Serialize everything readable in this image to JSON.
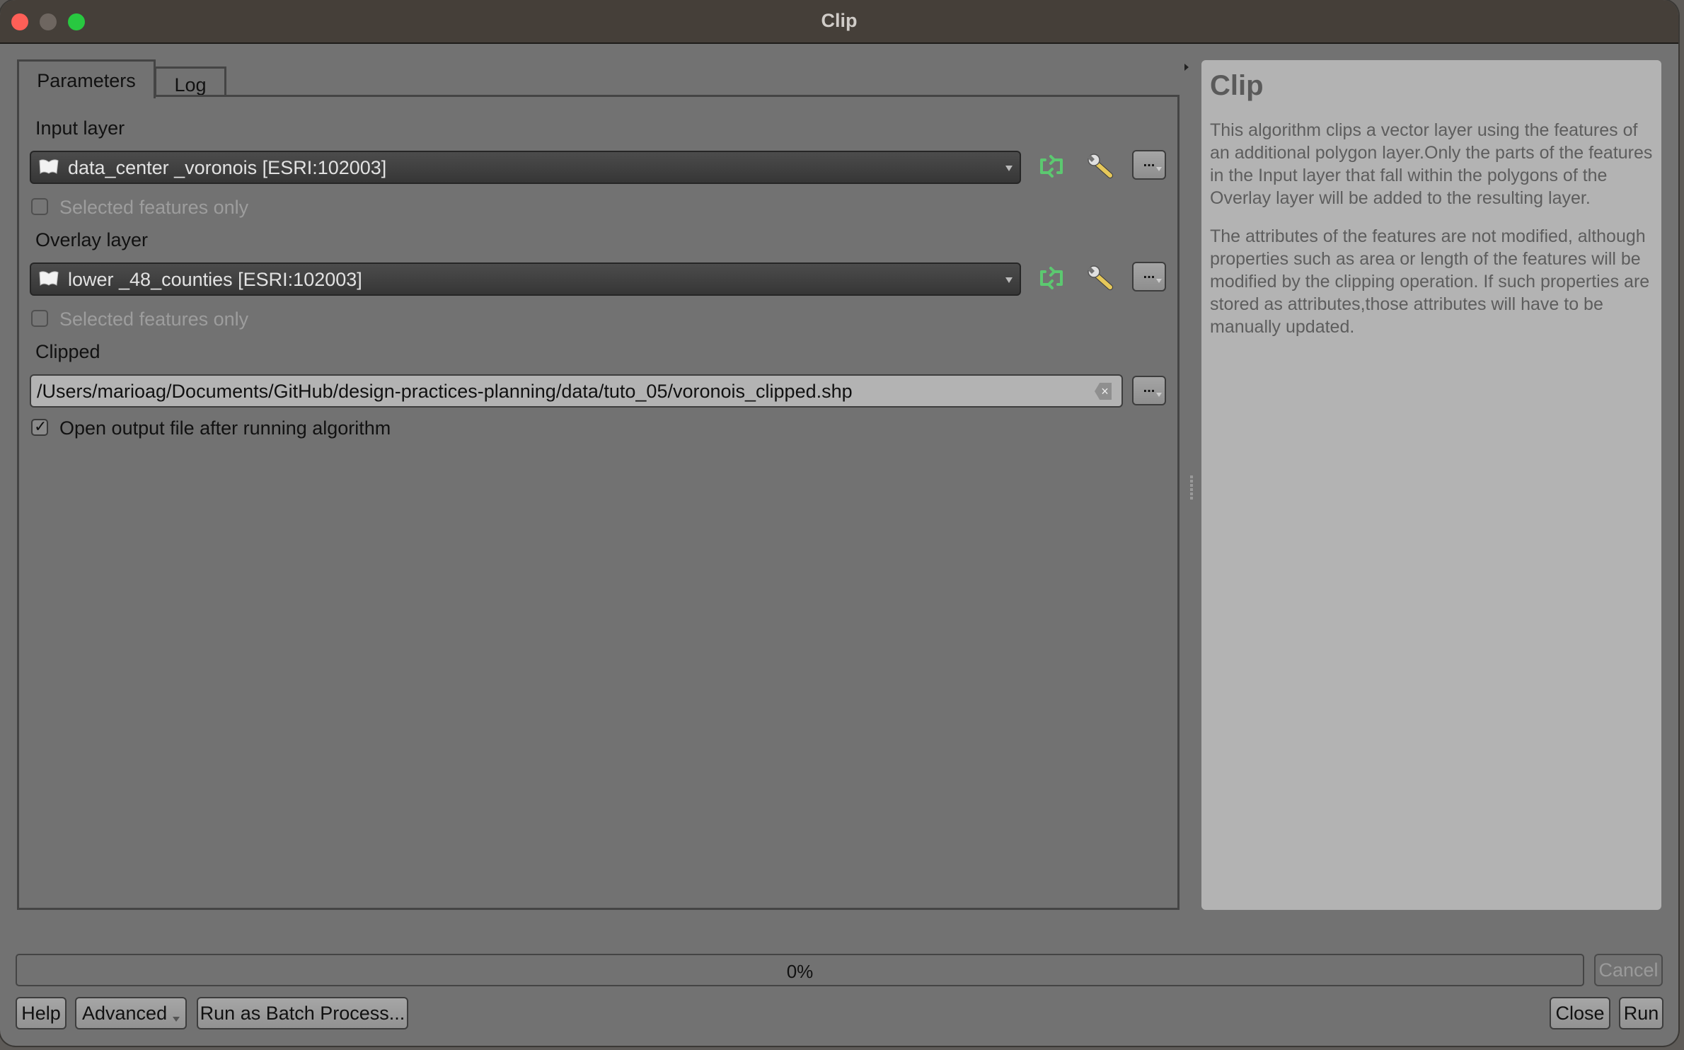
{
  "window": {
    "title": "Clip"
  },
  "tabs": [
    {
      "label": "Parameters",
      "active": true
    },
    {
      "label": "Log",
      "active": false
    }
  ],
  "params": {
    "input_layer": {
      "label": "Input layer",
      "value": "data_center _voronois [ESRI:102003]",
      "icon": "polygon-layer-icon",
      "selected_only_label": "Selected features only",
      "selected_only_checked": false
    },
    "overlay_layer": {
      "label": "Overlay layer",
      "value": "lower _48_counties [ESRI:102003]",
      "icon": "polygon-layer-icon",
      "selected_only_label": "Selected features only",
      "selected_only_checked": false
    },
    "clipped": {
      "label": "Clipped",
      "value": "/Users/marioag/Documents/GitHub/design-practices-planning/data/tuto_05/voronois_clipped.shp",
      "clear_icon": "clear-icon"
    },
    "open_output": {
      "label": "Open output file after running algorithm",
      "checked": true
    },
    "browse_label": "...",
    "iterate_icon": "iterate-icon",
    "settings_icon": "wrench-icon"
  },
  "help": {
    "title": "Clip",
    "paragraphs": [
      "This algorithm clips a vector layer using the features of an additional polygon layer.Only the parts of the features in the Input layer that fall within the polygons of the Overlay layer will be added to the resulting layer.",
      "The attributes of the features are not modified, although properties such as area or length of the features will be modified by the clipping operation. If such properties are stored as attributes,those attributes will have to be manually updated."
    ]
  },
  "progress": {
    "percent": 0,
    "text": "0%"
  },
  "buttons": {
    "cancel": "Cancel",
    "help": "Help",
    "advanced": "Advanced",
    "batch": "Run as Batch Process...",
    "close": "Close",
    "run": "Run"
  },
  "colors": {
    "titlebar": "#453f39",
    "window_bg": "#727272",
    "help_bg": "#b3b3b3",
    "iterate_green": "#5cc870",
    "close_light": "#fe5f57",
    "maximize_light": "#28c840"
  }
}
